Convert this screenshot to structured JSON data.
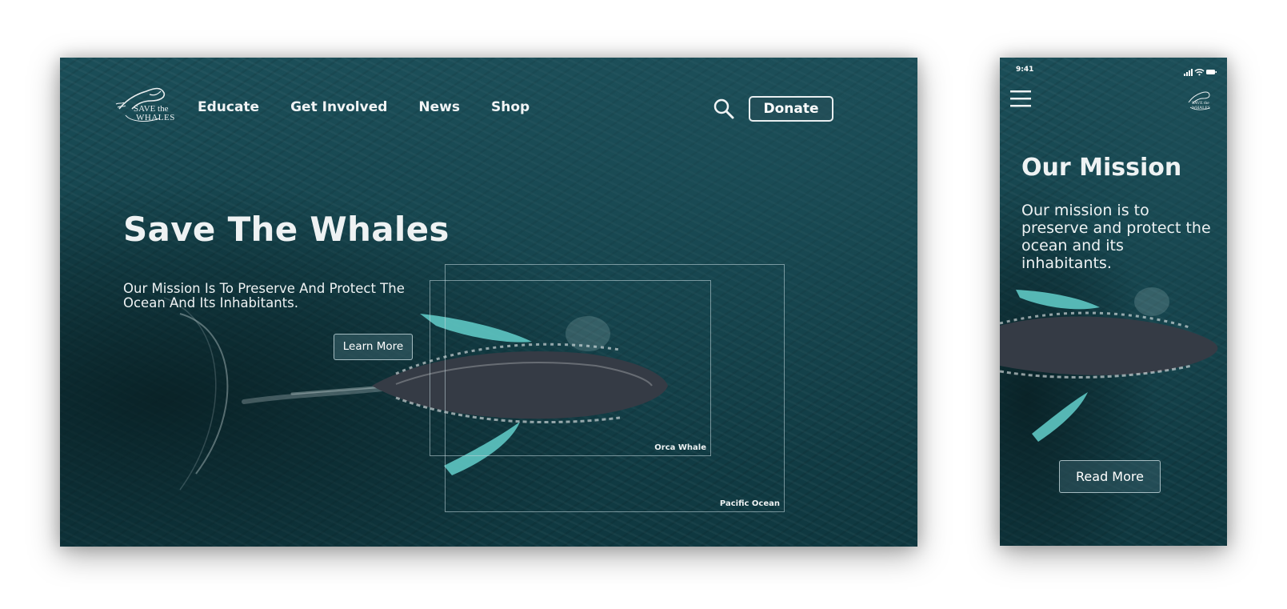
{
  "colors": {
    "ocean_dark": "#0f3840",
    "ocean_mid": "#1b4e58",
    "text": "#eef2f3",
    "fin_highlight": "#6fd0cc"
  },
  "desktop": {
    "logo": {
      "icon": "whale-logo-icon",
      "line1": "SAVE the",
      "line2": "WHALES"
    },
    "nav": [
      "Educate",
      "Get Involved",
      "News",
      "Shop"
    ],
    "search_icon": "search-icon",
    "donate_label": "Donate",
    "hero": {
      "title": "Save The Whales",
      "subtitle": "Our Mission Is To Preserve And Protect The Ocean And Its Inhabitants.",
      "button_label": "Learn More"
    },
    "annotations": {
      "orca_label": "Orca Whale",
      "ocean_label": "Pacific Ocean"
    }
  },
  "mobile": {
    "status_time": "9:41",
    "status_icons": [
      "signal-icon",
      "wifi-icon",
      "battery-icon"
    ],
    "menu_icon": "hamburger-menu-icon",
    "logo": {
      "line1": "SAVE the",
      "line2": "WHALES"
    },
    "title": "Our Mission",
    "text": "Our mission is to preserve and protect the ocean and its inhabitants.",
    "button_label": "Read More"
  }
}
